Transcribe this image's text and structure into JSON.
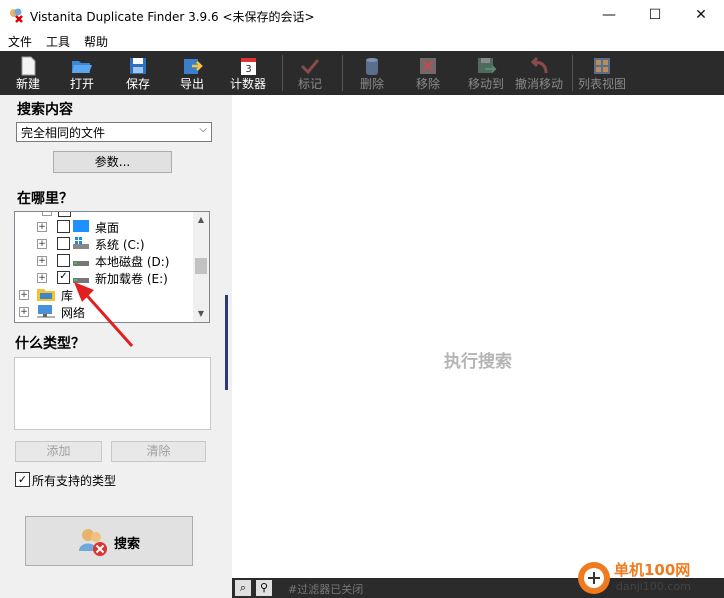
{
  "window": {
    "title": "Vistanita Duplicate Finder 3.9.6 <未保存的会话>",
    "controls": [
      "—",
      "☐",
      "✕"
    ]
  },
  "menu": [
    "文件",
    "工具",
    "帮助"
  ],
  "toolbar": [
    {
      "label": "新建",
      "icon": "new-doc-icon",
      "enabled": true
    },
    {
      "label": "打开",
      "icon": "open-folder-icon",
      "enabled": true
    },
    {
      "label": "保存",
      "icon": "save-disk-icon",
      "enabled": true
    },
    {
      "label": "导出",
      "icon": "export-icon",
      "enabled": true
    },
    {
      "label": "计数器",
      "icon": "counter-calendar-icon",
      "enabled": true
    },
    {
      "label": "标记",
      "icon": "checkmark-icon",
      "enabled": false
    },
    {
      "label": "删除",
      "icon": "trash-icon",
      "enabled": false
    },
    {
      "label": "移除",
      "icon": "remove-x-icon",
      "enabled": false
    },
    {
      "label": "移动到",
      "icon": "move-to-icon",
      "enabled": false
    },
    {
      "label": "撤消移动",
      "icon": "undo-icon",
      "enabled": false
    },
    {
      "label": "列表视图",
      "icon": "list-view-icon",
      "enabled": false
    }
  ],
  "search_content": {
    "heading": "搜索内容",
    "mode": "完全相同的文件",
    "params_button": "参数..."
  },
  "where": {
    "heading": "在哪里？",
    "tree": [
      {
        "label": "桌面",
        "checked": false,
        "icon": "desktop-icon"
      },
      {
        "label": "系统 (C:)",
        "checked": false,
        "icon": "windows-drive-icon"
      },
      {
        "label": "本地磁盘 (D:)",
        "checked": false,
        "icon": "drive-icon"
      },
      {
        "label": "新加载卷 (E:)",
        "checked": true,
        "icon": "drive-icon"
      },
      {
        "label": "库",
        "icon": "library-icon"
      },
      {
        "label": "网络",
        "icon": "network-icon"
      }
    ]
  },
  "types": {
    "heading": "什么类型？",
    "add_button": "添加",
    "clear_button": "清除",
    "all_supported_label": "所有支持的类型",
    "all_supported_checked": true
  },
  "search_button": "搜索",
  "main": {
    "placeholder": "执行搜索"
  },
  "filterbar": {
    "status": "#过滤器已关闭"
  },
  "watermark": {
    "cn": "单机100网",
    "url": "danji100.com"
  }
}
